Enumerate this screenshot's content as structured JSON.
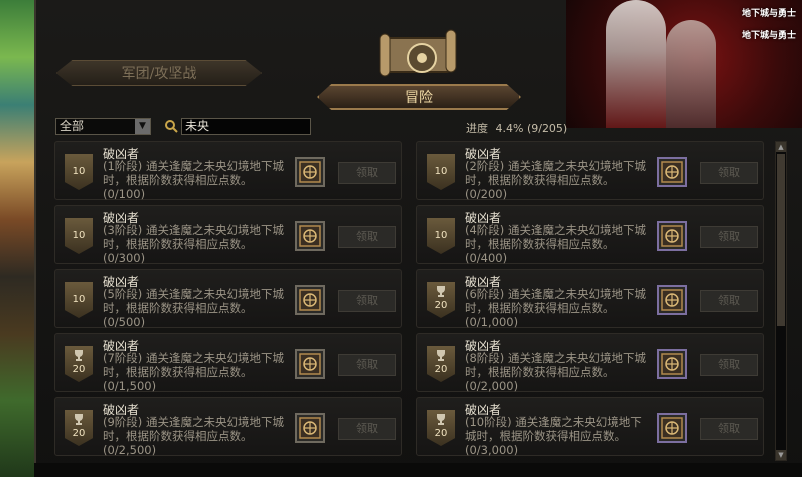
{
  "tabs": {
    "legion": "军团/攻坚战",
    "adventure": "冒险"
  },
  "filter": {
    "selected": "全部"
  },
  "search": {
    "value": "未央"
  },
  "progress": {
    "label": "进度",
    "value": "4.4% (9/205)"
  },
  "banner": {
    "logo_top": "地下城与勇士",
    "logo_bottom": "地下城与勇士"
  },
  "claim_label": "领取",
  "achievements": [
    {
      "title": "破凶者",
      "desc": "(1阶段) 通关逢魔之未央幻境地下城时，根据阶数获得相应点数。",
      "count": "(0/100)",
      "points": "10"
    },
    {
      "title": "破凶者",
      "desc": "(2阶段) 通关逢魔之未央幻境地下城时，根据阶数获得相应点数。",
      "count": "(0/200)",
      "points": "10"
    },
    {
      "title": "破凶者",
      "desc": "(3阶段) 通关逢魔之未央幻境地下城时，根据阶数获得相应点数。",
      "count": "(0/300)",
      "points": "10"
    },
    {
      "title": "破凶者",
      "desc": "(4阶段) 通关逢魔之未央幻境地下城时，根据阶数获得相应点数。",
      "count": "(0/400)",
      "points": "10"
    },
    {
      "title": "破凶者",
      "desc": "(5阶段) 通关逢魔之未央幻境地下城时，根据阶数获得相应点数。",
      "count": "(0/500)",
      "points": "10"
    },
    {
      "title": "破凶者",
      "desc": "(6阶段) 通关逢魔之未央幻境地下城时，根据阶数获得相应点数。",
      "count": "(0/1,000)",
      "points": "20"
    },
    {
      "title": "破凶者",
      "desc": "(7阶段) 通关逢魔之未央幻境地下城时，根据阶数获得相应点数。",
      "count": "(0/1,500)",
      "points": "20"
    },
    {
      "title": "破凶者",
      "desc": "(8阶段) 通关逢魔之未央幻境地下城时，根据阶数获得相应点数。",
      "count": "(0/2,000)",
      "points": "20"
    },
    {
      "title": "破凶者",
      "desc": "(9阶段) 通关逢魔之未央幻境地下城时，根据阶数获得相应点数。",
      "count": "(0/2,500)",
      "points": "20"
    },
    {
      "title": "破凶者",
      "desc": "(10阶段) 通关逢魔之未央幻境地下城时，根据阶数获得相应点数。",
      "count": "(0/3,000)",
      "points": "20"
    }
  ]
}
